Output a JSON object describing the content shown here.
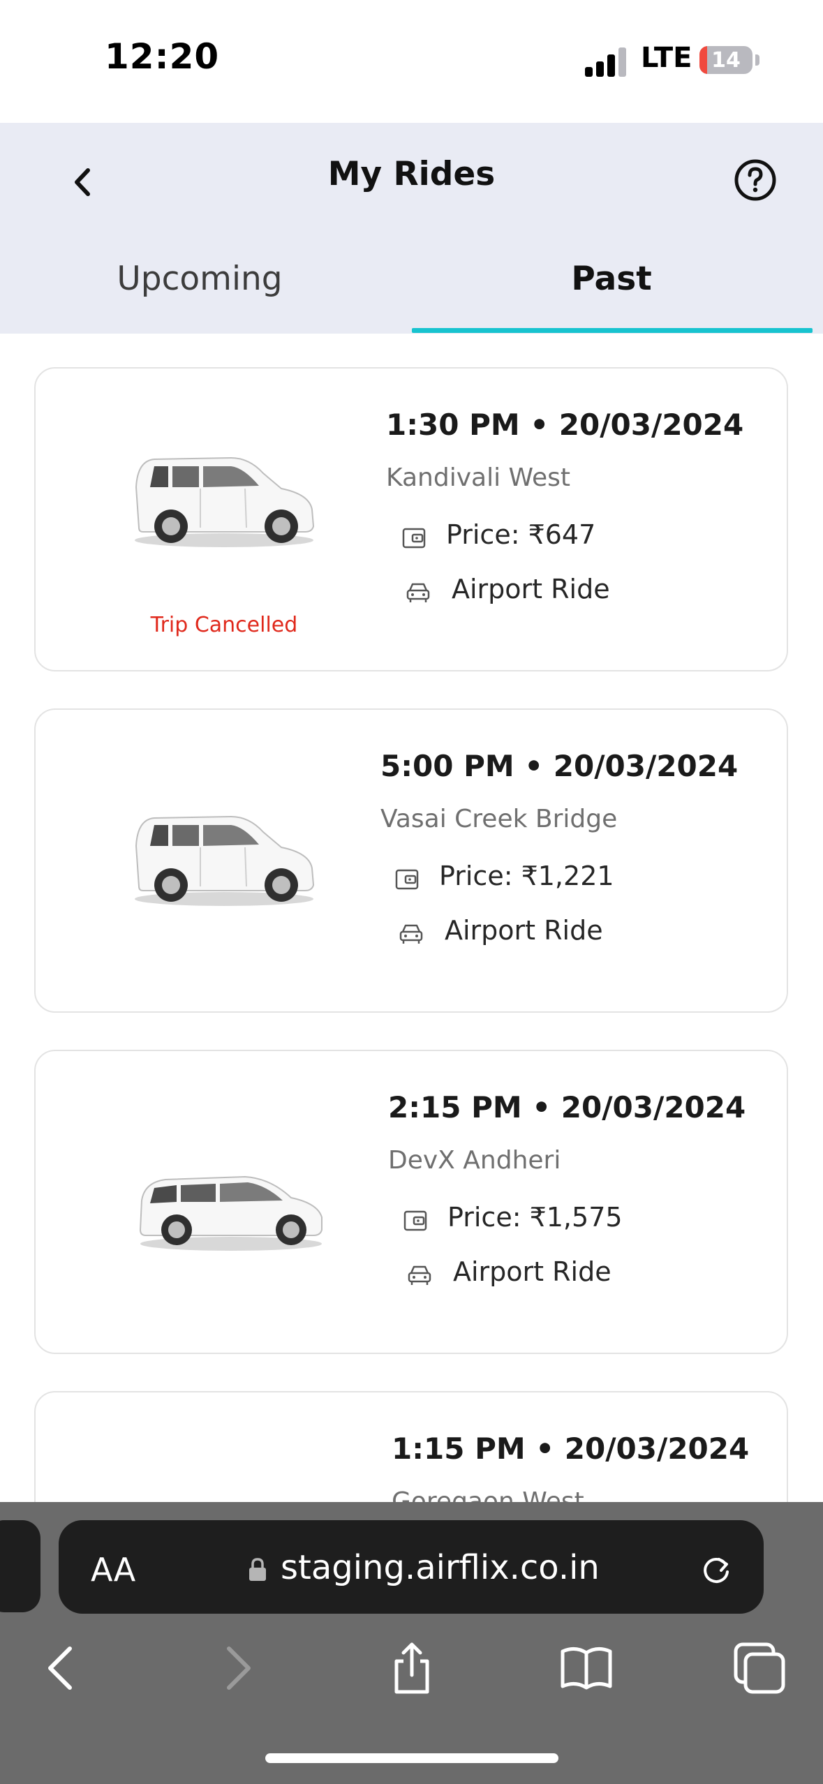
{
  "status_bar": {
    "time": "12:20",
    "network": "LTE",
    "battery_percent": "14",
    "battery_level": 0.14
  },
  "header": {
    "title": "My Rides",
    "back_icon": "chevron-left-icon",
    "help_icon": "question-circle-icon"
  },
  "tabs": [
    {
      "label": "Upcoming",
      "active": false
    },
    {
      "label": "Past",
      "active": true
    }
  ],
  "accent_color": "#17c3cf",
  "rides": [
    {
      "time": "1:30 PM • 20/03/2024",
      "location": "Kandivali West",
      "price": "Price: ₹647",
      "type": "Airport Ride",
      "status": "Trip Cancelled",
      "car": "hatchback"
    },
    {
      "time": "5:00 PM • 20/03/2024",
      "location": "Vasai Creek Bridge",
      "price": "Price: ₹1,221",
      "type": "Airport Ride",
      "status": "",
      "car": "hatchback"
    },
    {
      "time": "2:15 PM • 20/03/2024",
      "location": "DevX Andheri",
      "price": "Price: ₹1,575",
      "type": "Airport Ride",
      "status": "",
      "car": "mpv"
    },
    {
      "time": "1:15 PM • 20/03/2024",
      "location": "Goregaon West",
      "price": "",
      "type": "",
      "status": "",
      "car": "hatchback"
    }
  ],
  "browser": {
    "text_size_label": "AA",
    "url": "staging.airflix.co.in",
    "toolbar_icons": [
      "back-icon",
      "forward-icon",
      "share-icon",
      "bookmarks-icon",
      "tabs-icon"
    ]
  }
}
